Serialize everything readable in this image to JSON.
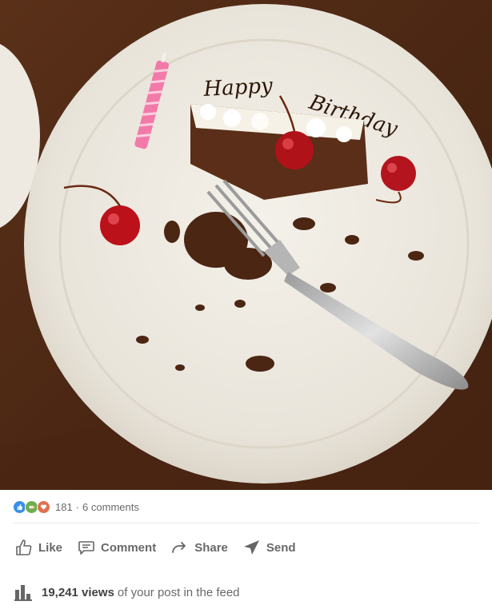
{
  "post": {
    "image_alt": "Plate with a slice of black forest cake, cherries, a pink candle and a fork, with Happy Birthday written in chocolate",
    "plate_text": "Happy Birthday"
  },
  "social": {
    "reaction_icons": [
      "like-icon",
      "celebrate-icon",
      "love-icon"
    ],
    "reaction_count": "181",
    "separator": "·",
    "comment_count": "6 comments"
  },
  "actions": {
    "like_label": "Like",
    "comment_label": "Comment",
    "share_label": "Share",
    "send_label": "Send"
  },
  "analytics": {
    "views_number": "19,241 views",
    "views_suffix": "of your post in the feed"
  },
  "colors": {
    "like_blue": "#378fe9",
    "celebrate_green": "#6dae4f",
    "love_orange": "#df704d",
    "text_secondary": "#666666"
  }
}
